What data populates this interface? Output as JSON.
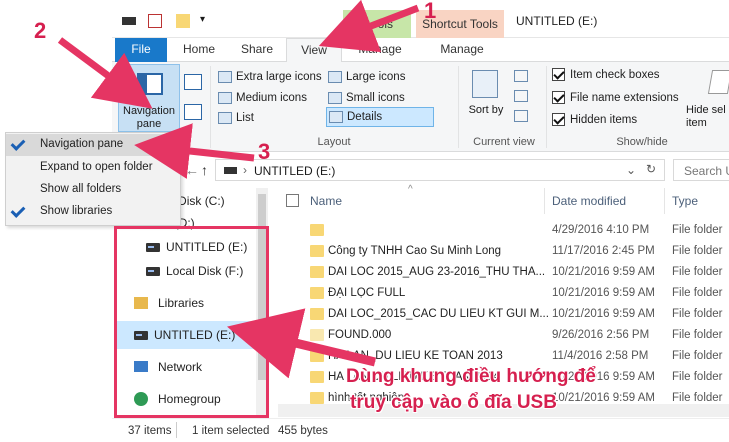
{
  "titlebar": {
    "context_tab_1": "...ools",
    "context_tab_2": "Shortcut Tools",
    "title": "UNTITLED (E:)"
  },
  "tabs": {
    "file": "File",
    "home": "Home",
    "share": "Share",
    "view": "View",
    "manage_1": "Manage",
    "manage_2": "Manage"
  },
  "ribbon": {
    "navigation_pane": "Navigation\npane",
    "layout_items": [
      "Extra large icons",
      "Large icons",
      "Medium icons",
      "Small icons",
      "List",
      "Details"
    ],
    "layout_label": "Layout",
    "sort_by": "Sort by",
    "current_view_label": "Current view",
    "item_check_boxes": "Item check boxes",
    "file_name_extensions": "File name extensions",
    "hidden_items": "Hidden items",
    "hide_selected": "Hide sel item",
    "show_hide_label": "Show/hide"
  },
  "address": {
    "path": "UNTITLED (E:)",
    "search_placeholder": "Search U"
  },
  "menu": {
    "items": [
      {
        "label": "Navigation pane",
        "checked": true
      },
      {
        "label": "Expand to open folder",
        "checked": false
      },
      {
        "label": "Show all folders",
        "checked": false
      },
      {
        "label": "Show libraries",
        "checked": true
      }
    ]
  },
  "nav": {
    "items": [
      "Local Disk (C:)",
      "Data (D:)",
      "UNTITLED (E:)",
      "Local Disk (F:)",
      "Libraries",
      "UNTITLED (E:)",
      "Network",
      "Homegroup"
    ]
  },
  "files": {
    "headers": {
      "name": "Name",
      "date": "Date modified",
      "type": "Type"
    },
    "rows": [
      {
        "name": "",
        "date": "4/29/2016 4:10 PM",
        "type": "File folder"
      },
      {
        "name": "Công ty TNHH Cao Su Minh Long",
        "date": "11/17/2016 2:45 PM",
        "type": "File folder"
      },
      {
        "name": "DAI LOC 2015_AUG 23-2016_THU THA...",
        "date": "10/21/2016 9:59 AM",
        "type": "File folder"
      },
      {
        "name": "ĐẠI LỘC FULL",
        "date": "10/21/2016 9:59 AM",
        "type": "File folder"
      },
      {
        "name": "DAI LOC_2015_CAC DU LIEU KT GUI M...",
        "date": "10/21/2016 9:59 AM",
        "type": "File folder"
      },
      {
        "name": "FOUND.000",
        "date": "9/26/2016 2:56 PM",
        "type": "File folder"
      },
      {
        "name": "HA LAN_DU LIEU KE TOAN 2013",
        "date": "11/4/2016 2:58 PM",
        "type": "File folder"
      },
      {
        "name": "HA LAN DU LIEU KE TOAN 2014",
        "date": "10/21/2016 9:59 AM",
        "type": "File folder"
      },
      {
        "name": "hình tốt nghiệp",
        "date": "10/21/2016 9:59 AM",
        "type": "File folder"
      }
    ]
  },
  "status": {
    "count": "37 items",
    "selected": "1 item selected",
    "size": "455 bytes"
  },
  "annotations": {
    "n1": "1",
    "n2": "2",
    "n3": "3",
    "caption_1": "Dùng khung điều hướng để",
    "caption_2": "truy cập vào ổ đĩa USB"
  },
  "colors": {
    "accent": "#1979ca",
    "annotation": "#d6204f",
    "selection": "#cce8ff"
  }
}
